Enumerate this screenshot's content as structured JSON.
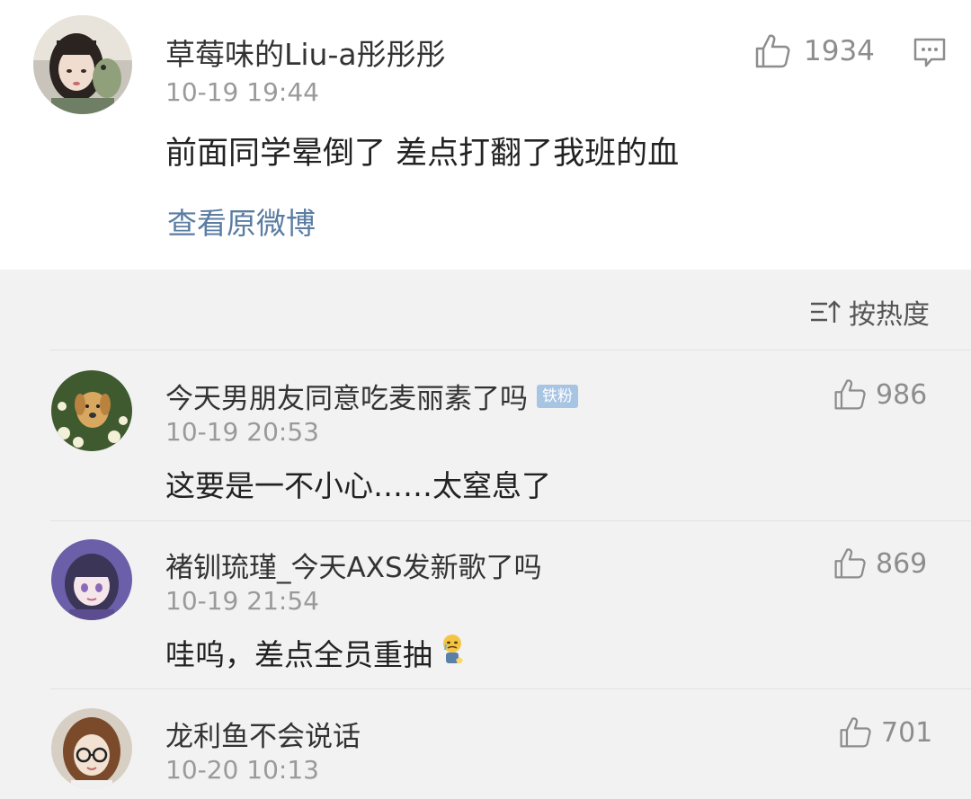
{
  "main_post": {
    "username": "草莓味的Liu-a彤彤彤",
    "timestamp": "10-19 19:44",
    "text": "前面同学晕倒了 差点打翻了我班的血",
    "likes": "1934",
    "view_original_label": "查看原微博",
    "like_icon": "thumbs-up-icon",
    "comment_icon": "comment-icon"
  },
  "sort": {
    "label": "按热度",
    "icon": "sort-icon"
  },
  "comments": [
    {
      "username": "今天男朋友同意吃麦丽素了吗",
      "badge": "铁粉",
      "timestamp": "10-19 20:53",
      "text": "这要是一不小心……太窒息了",
      "likes": "986"
    },
    {
      "username": "褚钏琉瑾_今天AXS发新歌了吗",
      "timestamp": "10-19 21:54",
      "text": "哇呜，差点全员重抽",
      "emoji": "crying-doll-emoji",
      "likes": "869"
    },
    {
      "username": "龙利鱼不会说话",
      "timestamp": "10-20 10:13",
      "likes": "701"
    }
  ],
  "colors": {
    "link": "#5b7da2",
    "timestamp": "#9a9a9a",
    "badge": "#a7c4e3",
    "background": "#f2f2f2"
  }
}
